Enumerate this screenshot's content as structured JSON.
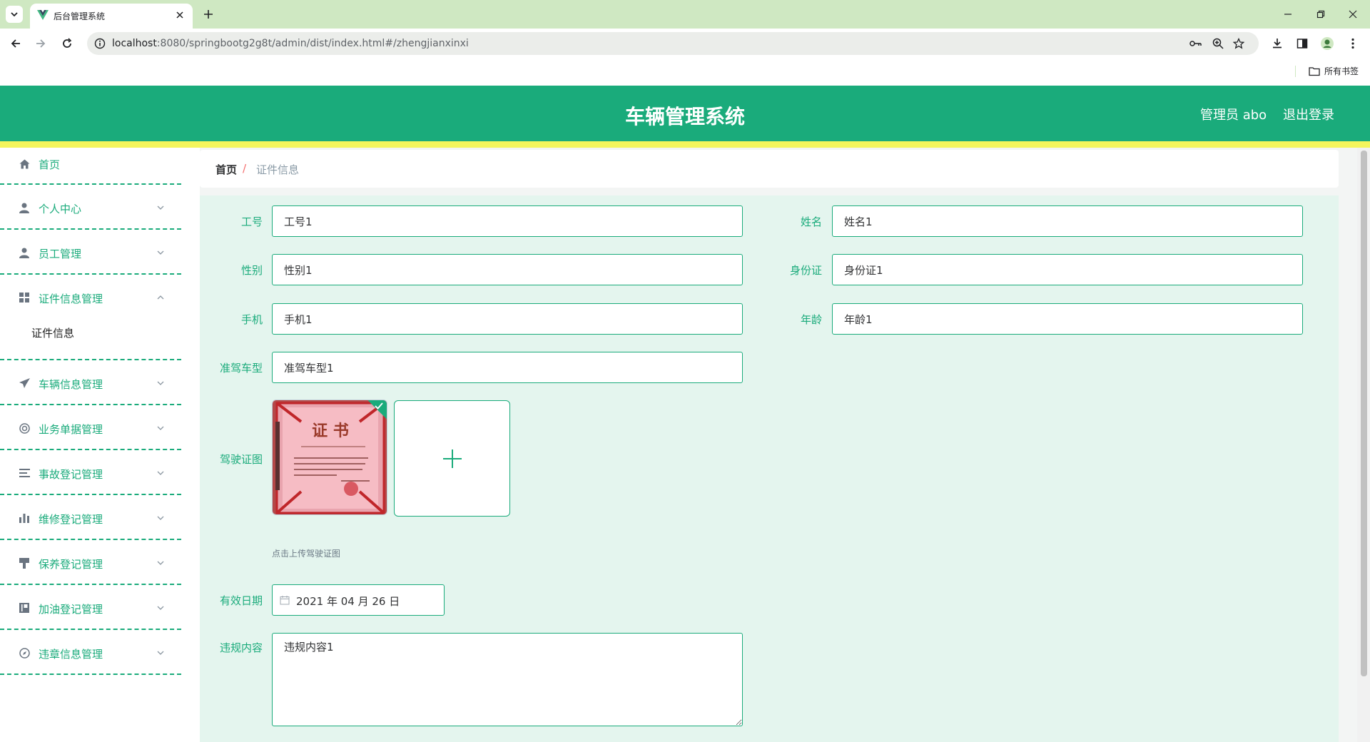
{
  "browser": {
    "tab_title": "后台管理系统",
    "url_host": "localhost",
    "url_rest": ":8080/springbootg2g8t/admin/dist/index.html#/zhengjianxinxi",
    "bookmarks_label": "所有书签"
  },
  "header": {
    "title": "车辆管理系统",
    "user": "管理员 abo",
    "logout": "退出登录"
  },
  "sidebar": {
    "items": [
      {
        "label": "首页",
        "icon": "home-icon"
      },
      {
        "label": "个人中心",
        "icon": "user-icon"
      },
      {
        "label": "员工管理",
        "icon": "user-icon"
      },
      {
        "label": "证件信息管理",
        "icon": "grid-icon",
        "children": [
          "证件信息"
        ]
      },
      {
        "label": "车辆信息管理",
        "icon": "paper-plane-icon"
      },
      {
        "label": "业务单据管理",
        "icon": "lifebuoy-icon"
      },
      {
        "label": "事故登记管理",
        "icon": "list-icon"
      },
      {
        "label": "维修登记管理",
        "icon": "bar-chart-icon"
      },
      {
        "label": "保养登记管理",
        "icon": "brush-icon"
      },
      {
        "label": "加油登记管理",
        "icon": "book-icon"
      },
      {
        "label": "违章信息管理",
        "icon": "compass-icon"
      }
    ]
  },
  "breadcrumb": {
    "home": "首页",
    "separator": "/",
    "current": "证件信息"
  },
  "form": {
    "gonghao": {
      "label": "工号",
      "value": "工号1"
    },
    "xingming": {
      "label": "姓名",
      "value": "姓名1"
    },
    "xingbie": {
      "label": "性别",
      "value": "性别1"
    },
    "shenfenzheng": {
      "label": "身份证",
      "value": "身份证1"
    },
    "shouji": {
      "label": "手机",
      "value": "手机1"
    },
    "nianling": {
      "label": "年龄",
      "value": "年龄1"
    },
    "zhunjiachexing": {
      "label": "准驾车型",
      "value": "准驾车型1"
    },
    "jiashizhengtu": {
      "label": "驾驶证图",
      "tip": "点击上传驾驶证图",
      "cert_title": "证 书"
    },
    "youxiaoriqi": {
      "label": "有效日期",
      "value": "2021 年 04 月 26 日"
    },
    "weiguineirong": {
      "label": "违规内容",
      "value": "违规内容1"
    }
  },
  "colors": {
    "primary": "#1aab7b",
    "header_bg": "#1aab7b",
    "accent_strip": "#f4f55c",
    "form_bg": "#e4f5ee"
  }
}
